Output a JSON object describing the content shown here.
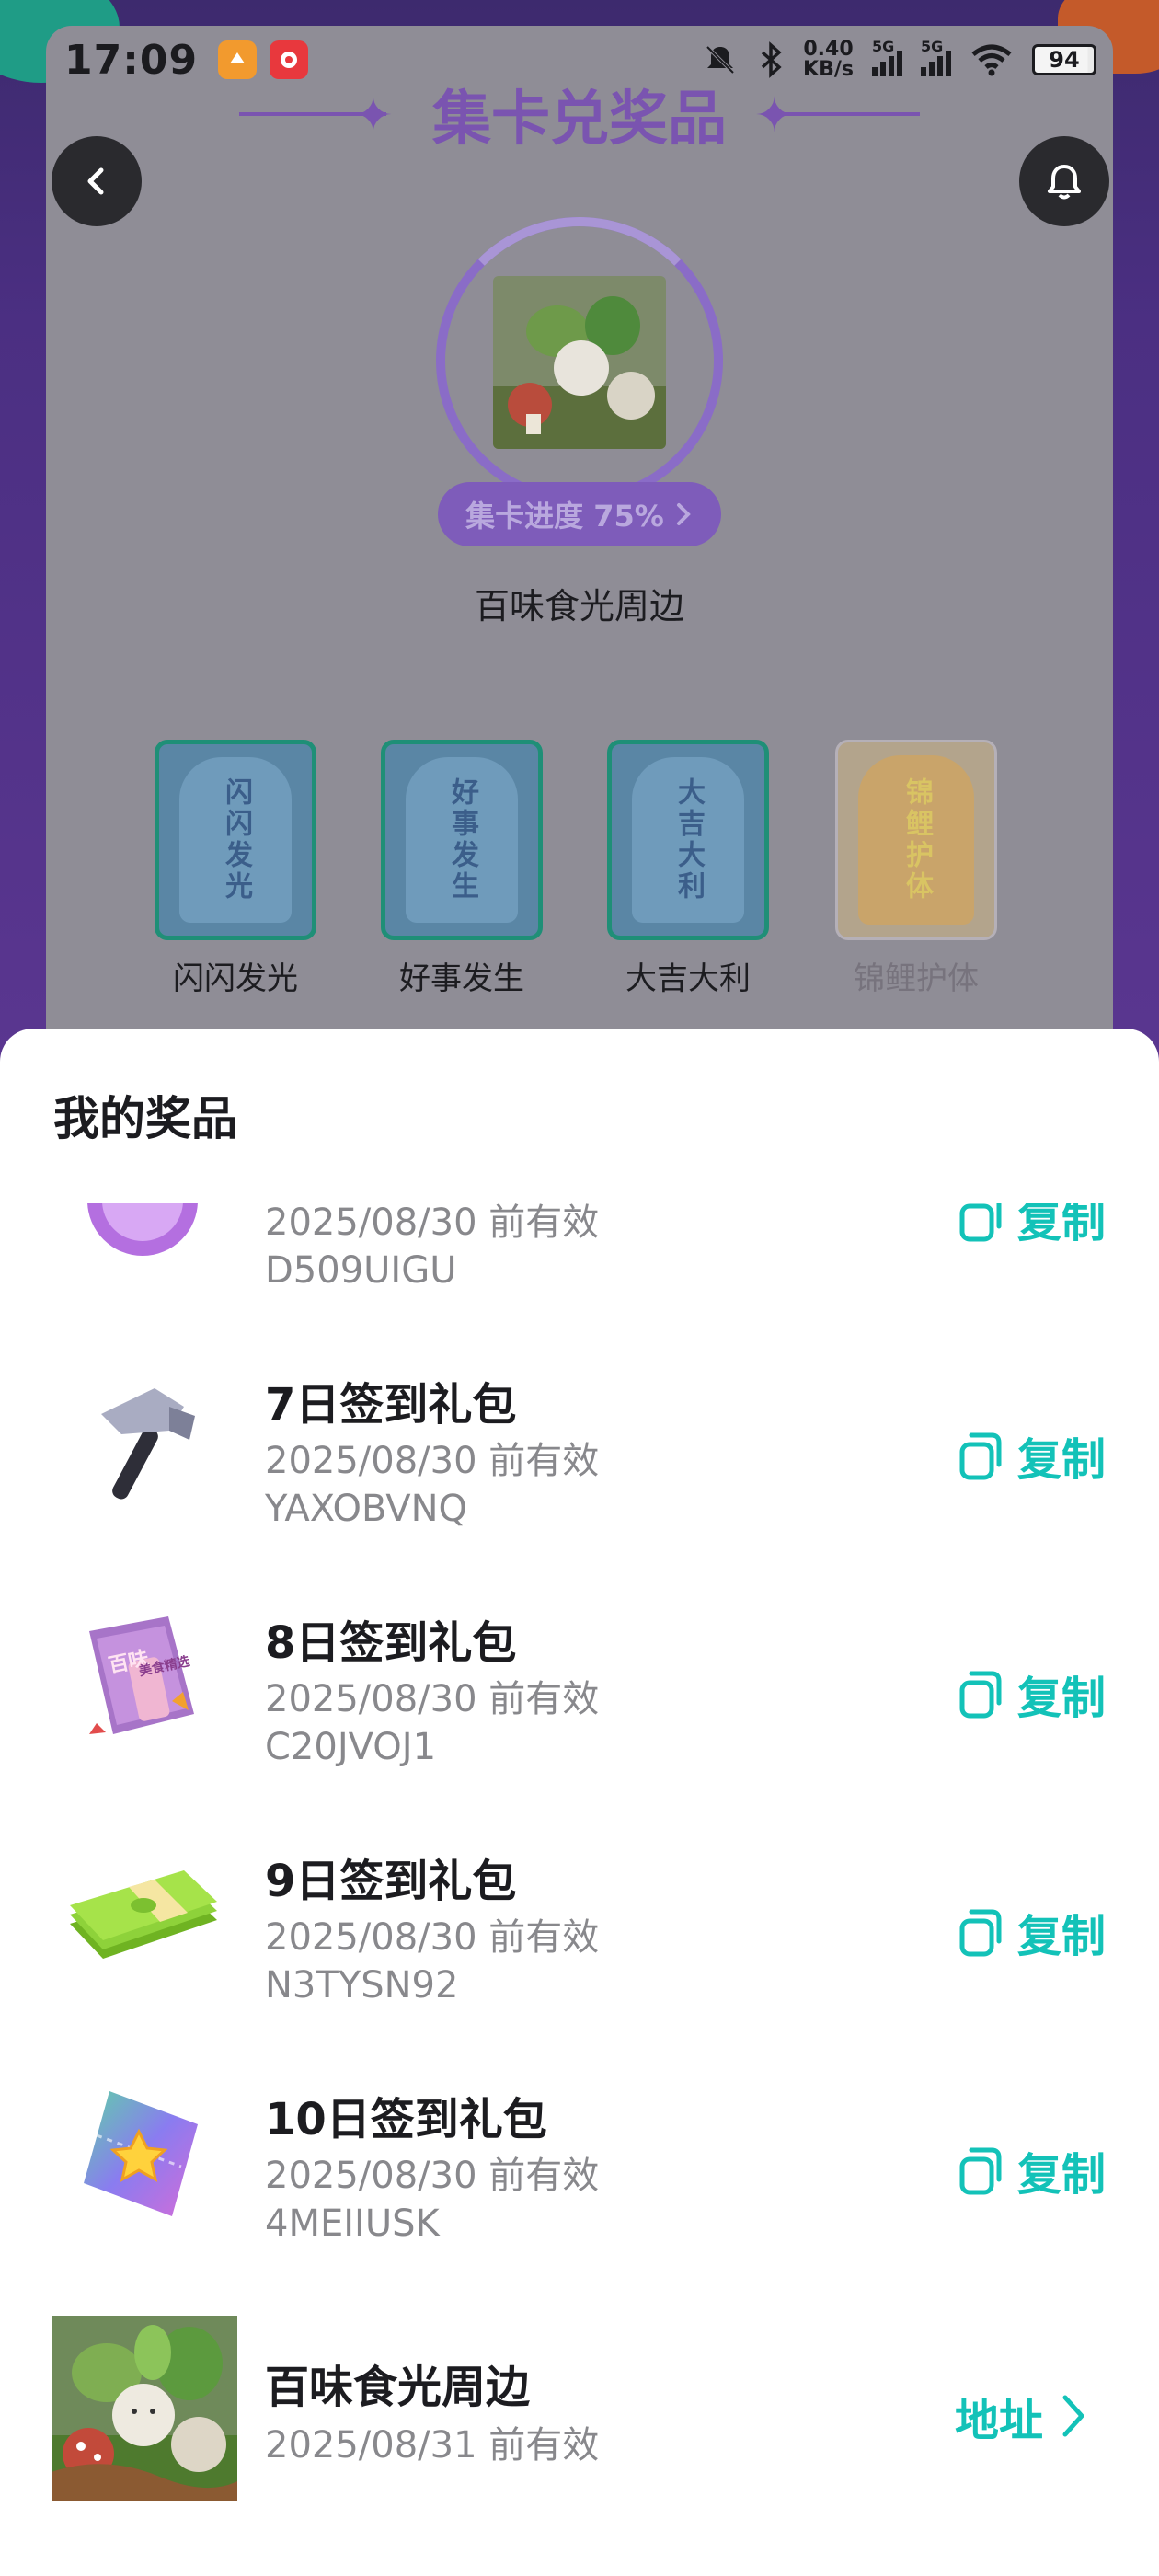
{
  "status_bar": {
    "time": "17:09",
    "net_speed_value": "0.40",
    "net_speed_unit": "KB/s",
    "sim1": "5G",
    "sim2": "5G",
    "battery": "94"
  },
  "header": {
    "title": "集卡兑奖品",
    "back_icon": "chevron-left-icon",
    "bell_icon": "bell-icon"
  },
  "prize_progress": {
    "label": "集卡进度 75%",
    "percent": 75,
    "prize_name": "百味食光周边"
  },
  "cards": [
    {
      "chars": "闪闪发光",
      "label": "闪闪发光",
      "collected": true
    },
    {
      "chars": "好事发生",
      "label": "好事发生",
      "collected": true
    },
    {
      "chars": "大吉大利",
      "label": "大吉大利",
      "collected": true
    },
    {
      "chars": "锦鲤护体",
      "label": "锦鲤护体",
      "collected": false
    }
  ],
  "sheet": {
    "title": "我的奖品",
    "copy_label": "复制",
    "address_label": "地址",
    "items": [
      {
        "title": "",
        "date": "2025/08/30 前有效",
        "code": "D509UIGU",
        "icon": "badge-icon"
      },
      {
        "title": "7日签到礼包",
        "date": "2025/08/30 前有效",
        "code": "YAXOBVNQ",
        "icon": "hammer-icon"
      },
      {
        "title": "8日签到礼包",
        "date": "2025/08/30 前有效",
        "code": "C20JVOJ1",
        "icon": "recipe-book-icon",
        "book_text_a": "百味",
        "book_text_b": "美食精选"
      },
      {
        "title": "9日签到礼包",
        "date": "2025/08/30 前有效",
        "code": "N3TYSN92",
        "icon": "cash-stack-icon"
      },
      {
        "title": "10日签到礼包",
        "date": "2025/08/30 前有效",
        "code": "4MEIIUSK",
        "icon": "star-ticket-icon"
      }
    ],
    "physical": {
      "title": "百味食光周边",
      "date": "2025/08/31 前有效",
      "icon": "food-figures-thumbnail"
    }
  }
}
